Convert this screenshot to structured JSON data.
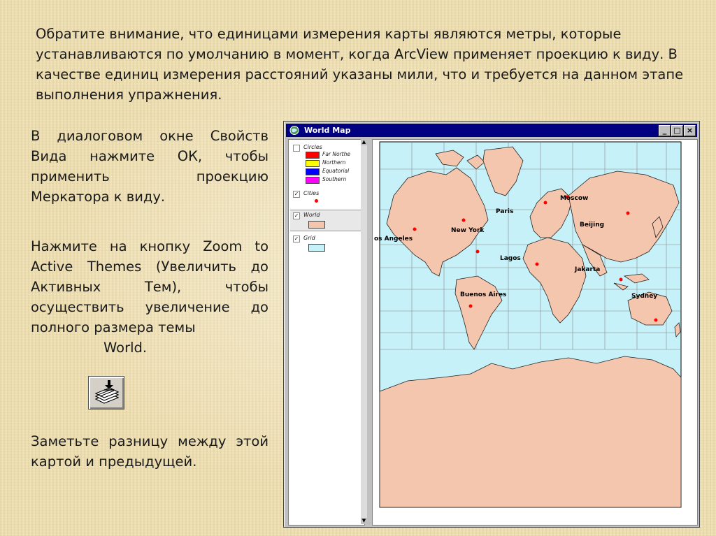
{
  "intro": "Обратите внимание, что единицами измерения карты являются метры, которые устанавливаются по умолчанию в момент, когда ArcView применяет проекцию к виду. В качестве единиц измерения расстояний указаны мили, что и требуется на данном этапе выполнения упражнения.",
  "para1": {
    "line1": "В диалоговом окне Свойств",
    "line2": "Вида нажмите ОК, чтобы",
    "line3": "применить проекцию",
    "line4": "Меркатора к виду."
  },
  "para2": {
    "line1": "Нажмите на кнопку Zoom to",
    "line2": "Active Themes (Увеличить до",
    "line3": "Активных Тем), чтобы",
    "line4": "осуществить увеличение до",
    "line5": "полного размера темы",
    "line6": "World."
  },
  "para3": {
    "line1": "Заметьте разницу между этой",
    "line2": "картой и предыдущей."
  },
  "window": {
    "title": "World Map",
    "buttons": {
      "minimize": "_",
      "maximize": "□",
      "close": "×"
    }
  },
  "legend": {
    "circles": {
      "name": "Circles",
      "classes": [
        {
          "label": "Far Northe",
          "color": "#ff0000"
        },
        {
          "label": "Northern",
          "color": "#ffff00"
        },
        {
          "label": "Equatorial",
          "color": "#0000ff"
        },
        {
          "label": "Southern",
          "color": "#ff00ff"
        }
      ]
    },
    "cities": {
      "name": "Cities",
      "checked": true,
      "color": "#ff0000"
    },
    "world": {
      "name": "World",
      "checked": true,
      "color": "#f5c6ae"
    },
    "grid": {
      "name": "Grid",
      "checked": true,
      "color": "#c6f1f8"
    }
  },
  "map": {
    "ocean_color": "#c6f1f8",
    "land_color": "#f5c6ae",
    "cities": [
      "Moscow",
      "Paris",
      "New York",
      "Beijing",
      "os Angeles",
      "Lagos",
      "Jakarta",
      "Sydney",
      "Buenos Aires"
    ]
  }
}
